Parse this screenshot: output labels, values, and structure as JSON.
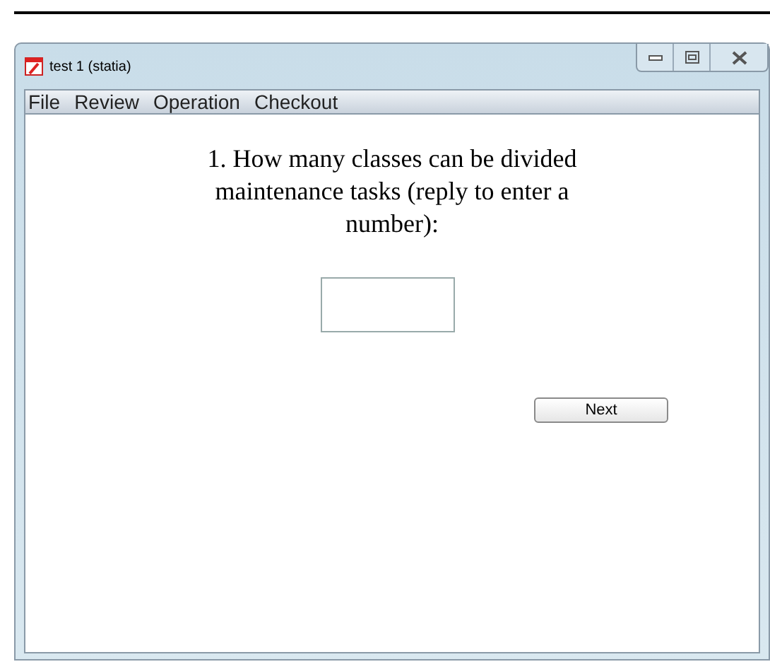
{
  "window": {
    "title": "test 1 (statia)"
  },
  "menu": [
    "File",
    "Review",
    "Operation",
    "Checkout"
  ],
  "question": "1.  How many classes can be divided maintenance tasks (reply to enter a number):",
  "buttons": [
    "Next"
  ]
}
